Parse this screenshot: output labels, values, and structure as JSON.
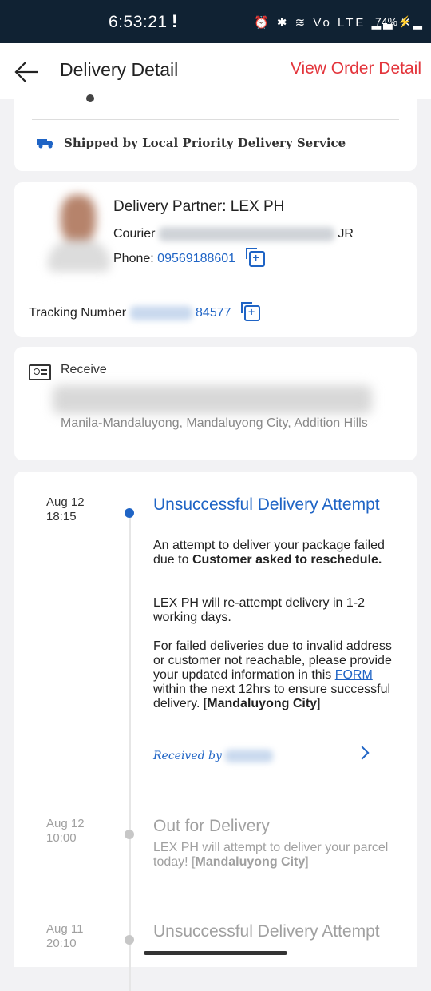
{
  "status_bar": {
    "time": "6:53:21",
    "alert": "!",
    "icons": "⏰ ✱ ≋ Vo LTE ▂▃ ✕▂",
    "battery": "74%⚡"
  },
  "header": {
    "title": "Delivery Detail",
    "view_order_label": "View Order Detail"
  },
  "shipping": {
    "service_text": "Shipped by Local Priority Delivery Service"
  },
  "partner": {
    "title": "Delivery Partner: LEX PH",
    "courier_label": "Courier",
    "courier_suffix": "JR",
    "phone_label": "Phone:",
    "phone": "09569188601",
    "tracking_label": "Tracking Number",
    "tracking_suffix": "84577"
  },
  "receiver": {
    "label": "Receive",
    "address_visible": "Manila-Mandaluyong, Mandaluyong City, Addition Hills"
  },
  "timeline": [
    {
      "date": "Aug 12",
      "time": "18:15",
      "title": "Unsuccessful Delivery Attempt",
      "p1_pre": "An attempt to deliver your package failed due to ",
      "p1_bold": "Customer asked to reschedule.",
      "p2": "LEX PH will re-attempt delivery in 1-2 working days.",
      "p3_pre": "For failed deliveries due to invalid address or customer not reachable, please provide your updated information in this ",
      "p3_link": "FORM",
      "p3_mid": " within the next 12hrs to ensure successful delivery. [",
      "p3_bold": "Mandaluyong City",
      "p3_end": "]",
      "received_by": "Received by"
    },
    {
      "date": "Aug 12",
      "time": "10:00",
      "title": "Out for Delivery",
      "desc_pre": "LEX PH will attempt to deliver your parcel today! [",
      "desc_bold": "Mandaluyong City",
      "desc_end": "]"
    },
    {
      "date": "Aug 11",
      "time": "20:10",
      "title": "Unsuccessful Delivery Attempt"
    }
  ],
  "colors": {
    "accent_red": "#e3343b",
    "link_blue": "#1f64c5",
    "status_bar": "#102233"
  }
}
